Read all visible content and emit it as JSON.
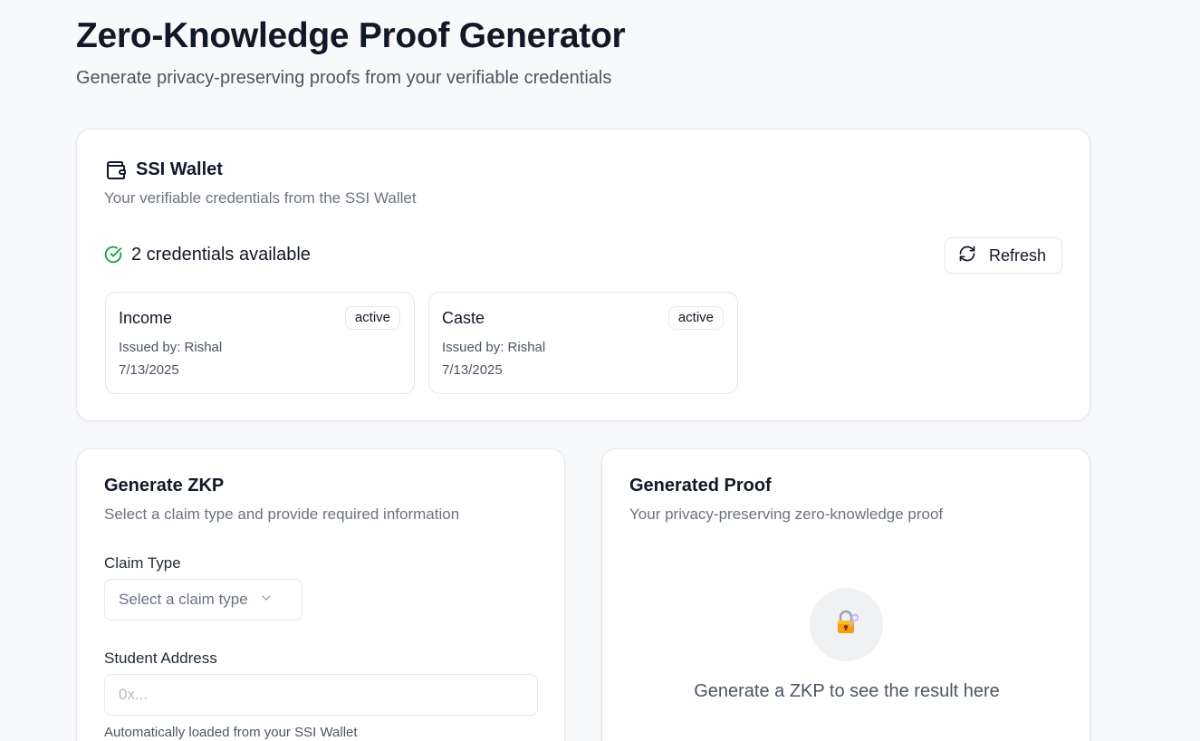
{
  "header": {
    "title": "Zero-Knowledge Proof Generator",
    "subtitle": "Generate privacy-preserving proofs from your verifiable credentials"
  },
  "wallet": {
    "title": "SSI Wallet",
    "description": "Your verifiable credentials from the SSI Wallet",
    "status_text": "2 credentials available",
    "refresh_label": "Refresh",
    "credentials": [
      {
        "name": "Income",
        "status": "active",
        "issuer": "Issued by: Rishal",
        "date": "7/13/2025"
      },
      {
        "name": "Caste",
        "status": "active",
        "issuer": "Issued by: Rishal",
        "date": "7/13/2025"
      }
    ]
  },
  "generate": {
    "title": "Generate ZKP",
    "description": "Select a claim type and provide required information",
    "claim_label": "Claim Type",
    "claim_placeholder": "Select a claim type",
    "address_label": "Student Address",
    "address_placeholder": "0x...",
    "address_help": "Automatically loaded from your SSI Wallet"
  },
  "proof": {
    "title": "Generated Proof",
    "description": "Your privacy-preserving zero-knowledge proof",
    "empty_text": "Generate a ZKP to see the result here"
  },
  "colors": {
    "background": "#f8f9fb",
    "success": "#16a34a",
    "lock": "#f59e0b"
  }
}
